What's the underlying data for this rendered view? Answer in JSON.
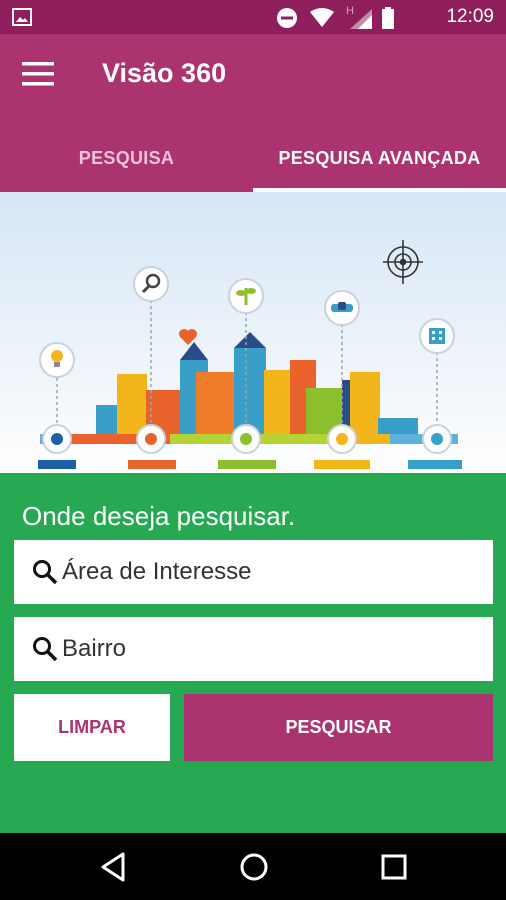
{
  "status_bar": {
    "time": "12:09",
    "network_letter": "H",
    "icons": [
      "image-icon",
      "do-not-disturb-icon",
      "wifi-icon",
      "signal-icon",
      "battery-icon"
    ]
  },
  "app_bar": {
    "title": "Visão 360",
    "menu_icon": "hamburger-menu-icon"
  },
  "tabs": [
    {
      "label": "PESQUISA",
      "active": false
    },
    {
      "label": "PESQUISA AVANÇADA",
      "active": true
    }
  ],
  "banner": {
    "description_icons": [
      "lightbulb-icon",
      "magnifier-icon",
      "plant-icon",
      "handshake-icon",
      "building-icon",
      "target-icon",
      "heart-icon"
    ],
    "pin_colors": [
      "#1d5fa8",
      "#e8642c",
      "#8bbf2c",
      "#f2b51c",
      "#3a9fc8"
    ]
  },
  "form": {
    "heading": "Onde deseja pesquisar.",
    "area_placeholder": "Área de Interesse",
    "bairro_placeholder": "Bairro",
    "clear_label": "LIMPAR",
    "search_label": "PESQUISAR"
  },
  "colors": {
    "primary": "#ab336f",
    "primary_dark": "#8e1f5c",
    "form_background": "#27a954"
  },
  "nav_bar": {
    "icons": [
      "back-icon",
      "home-icon",
      "recents-icon"
    ]
  }
}
